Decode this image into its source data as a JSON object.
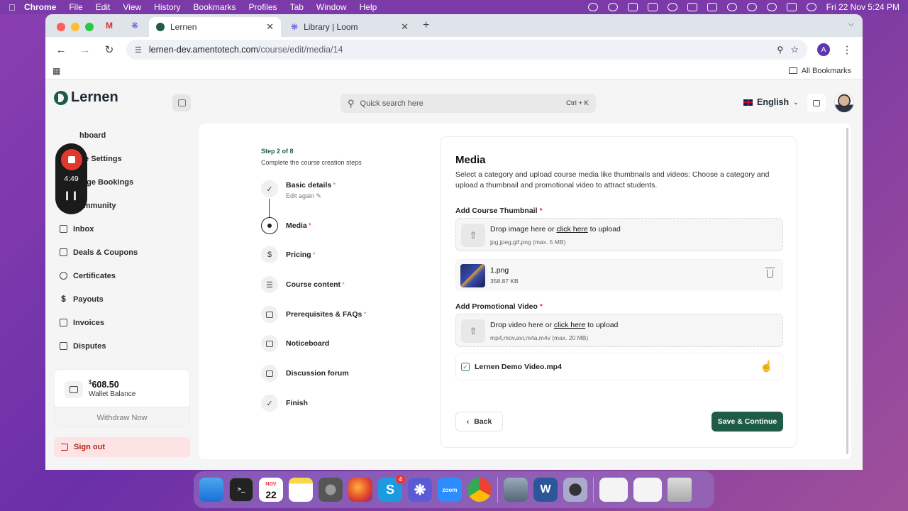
{
  "menubar": {
    "items": [
      "Chrome",
      "File",
      "Edit",
      "View",
      "History",
      "Bookmarks",
      "Profiles",
      "Tab",
      "Window",
      "Help"
    ],
    "datetime": "Fri 22 Nov  5:24 PM"
  },
  "browser": {
    "tabs": [
      {
        "label": "Lernen"
      },
      {
        "label": "Library | Loom"
      }
    ],
    "url_domain": "lernen-dev.amentotech.com",
    "url_path": "/course/edit/media/14",
    "profile_initial": "A",
    "all_bookmarks": "All Bookmarks"
  },
  "app": {
    "brand": "Lernen",
    "search_placeholder": "Quick search here",
    "search_shortcut": "Ctrl + K",
    "language": "English"
  },
  "sidebar": {
    "items": [
      {
        "label": "hboard"
      },
      {
        "label": "le Settings"
      },
      {
        "label": "age Bookings"
      },
      {
        "label": "Community"
      },
      {
        "label": "Inbox"
      },
      {
        "label": "Deals & Coupons"
      },
      {
        "label": "Certificates"
      },
      {
        "label": "Payouts"
      },
      {
        "label": "Invoices"
      },
      {
        "label": "Disputes"
      }
    ],
    "wallet": {
      "currency": "$",
      "amount": "608.50",
      "label": "Wallet Balance",
      "withdraw": "Withdraw Now"
    },
    "signout": "Sign out"
  },
  "recorder": {
    "time": "4:49"
  },
  "steps": {
    "heading": "Step 2 of 8",
    "subheading": "Complete the course creation steps",
    "items": [
      {
        "label": "Basic details",
        "sub": "Edit again"
      },
      {
        "label": "Media"
      },
      {
        "label": "Pricing"
      },
      {
        "label": "Course content"
      },
      {
        "label": "Prerequisites & FAQs"
      },
      {
        "label": "Noticeboard"
      },
      {
        "label": "Discussion forum"
      },
      {
        "label": "Finish"
      }
    ],
    "required_mark": "*"
  },
  "media": {
    "title": "Media",
    "description": "Select a category and upload course media like thumbnails and videos: Choose a category and upload a thumbnail and promotional video to attract students.",
    "thumbnail": {
      "label": "Add Course Thumbnail",
      "drop_prefix": "Drop image here or ",
      "drop_link": "click here",
      "drop_suffix": " to upload",
      "hint": "jpg,jpeg,gif,png (max. 5 MB)",
      "file_name": "1.png",
      "file_size": "358.87 KB"
    },
    "video": {
      "label": "Add Promotional Video",
      "drop_prefix": "Drop video here or ",
      "drop_link": "click here",
      "drop_suffix": " to upload",
      "hint": "mp4,mov,avi,m4a,m4v (max. 20 MB)",
      "file_name": "Lernen Demo Video.mp4"
    },
    "back": "Back",
    "save": "Save & Continue"
  },
  "dock": {
    "calendar_month": "NOV",
    "calendar_day": "22",
    "skype_badge": "4",
    "zoom_label": "zoom"
  },
  "colors": {
    "brand_green": "#1e5c47",
    "danger": "#b42318"
  }
}
